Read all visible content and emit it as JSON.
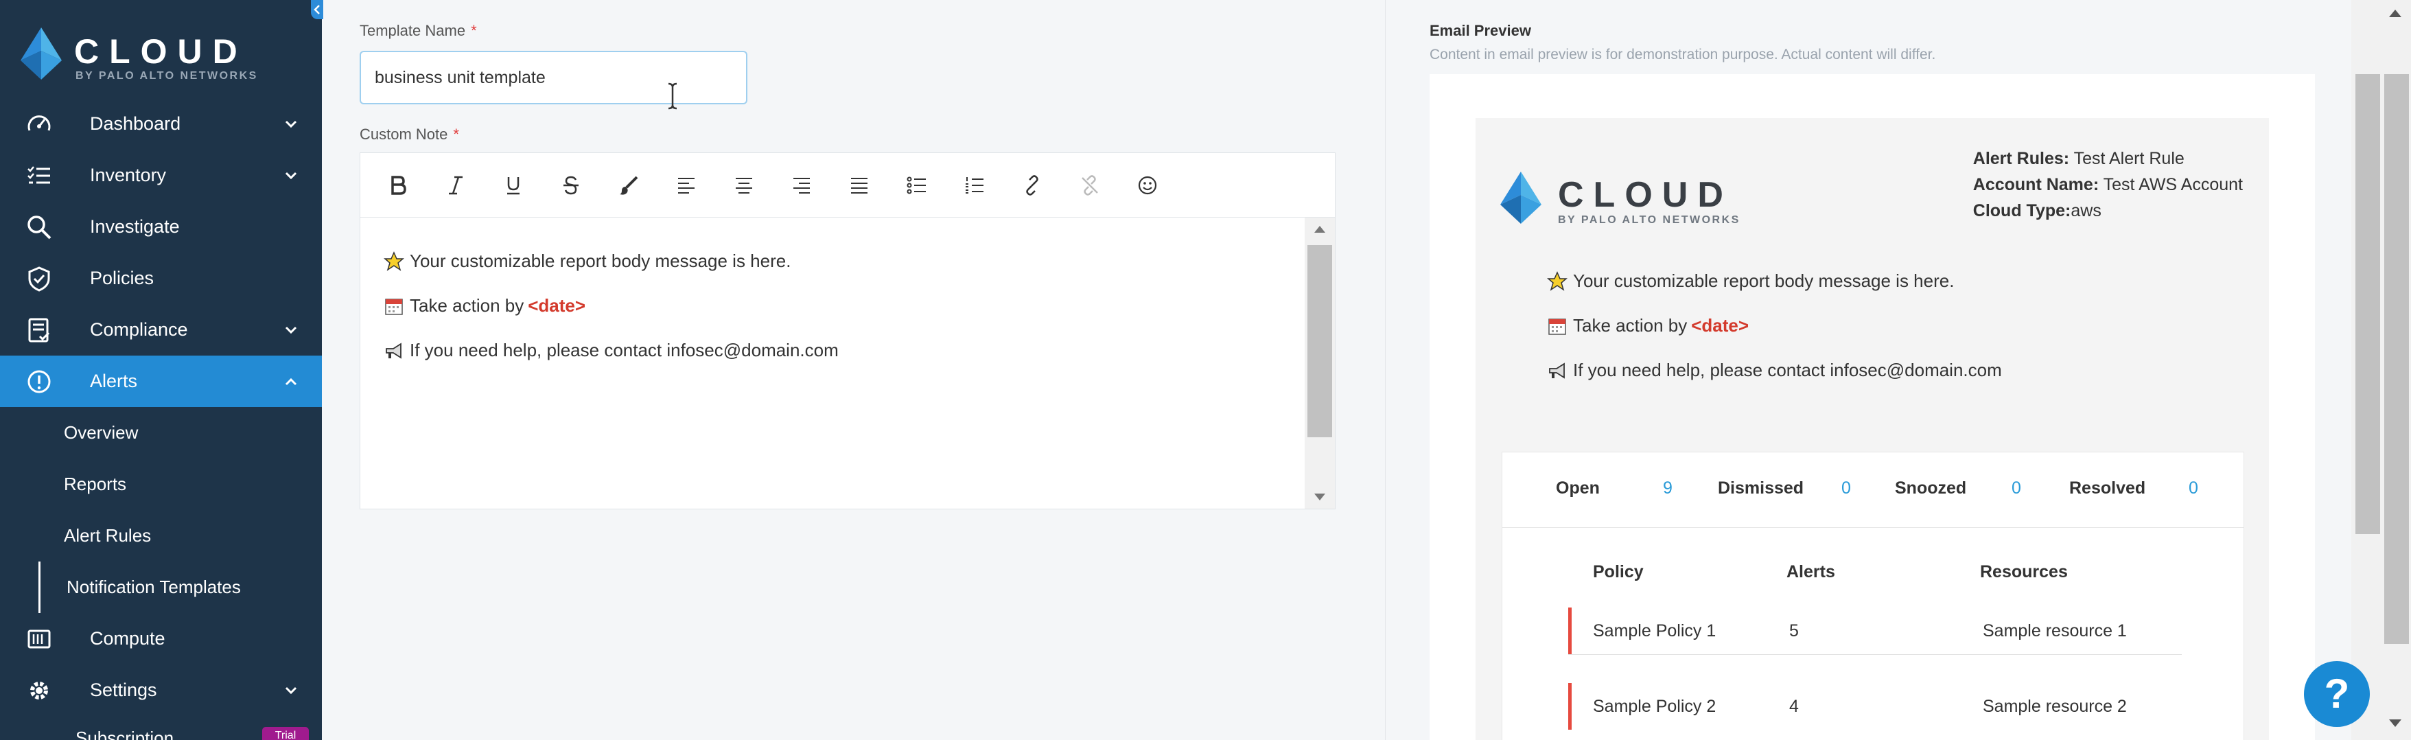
{
  "brand": {
    "name": "CLOUD",
    "tagline": "BY PALO ALTO NETWORKS"
  },
  "sidebar": {
    "items": [
      {
        "label": "Dashboard",
        "icon": "speedometer-icon",
        "has_children": true
      },
      {
        "label": "Inventory",
        "icon": "list-icon",
        "has_children": true
      },
      {
        "label": "Investigate",
        "icon": "search-icon",
        "has_children": false
      },
      {
        "label": "Policies",
        "icon": "shield-check-icon",
        "has_children": false
      },
      {
        "label": "Compliance",
        "icon": "report-icon",
        "has_children": true
      },
      {
        "label": "Alerts",
        "icon": "alert-circle-icon",
        "has_children": true,
        "expanded": true
      }
    ],
    "alerts_children": [
      {
        "label": "Overview"
      },
      {
        "label": "Reports"
      },
      {
        "label": "Alert Rules"
      },
      {
        "label": "Notification Templates",
        "current": true
      }
    ],
    "after_items": [
      {
        "label": "Compute",
        "icon": "server-icon",
        "has_children": false
      },
      {
        "label": "Settings",
        "icon": "gear-icon",
        "has_children": true
      }
    ],
    "partial_item": {
      "label": "Subscription",
      "badge": "Trial"
    }
  },
  "form": {
    "template_name_label": "Template Name",
    "template_name_value": "business unit template",
    "custom_note_label": "Custom Note",
    "required_mark": "*",
    "toolbar": [
      "bold",
      "italic",
      "underline",
      "strikethrough",
      "brush",
      "align-left",
      "align-center",
      "align-right",
      "align-justify",
      "bulleted-list",
      "numbered-list",
      "link",
      "unlink",
      "emoji"
    ],
    "note_lines": [
      {
        "emoji": "star",
        "text": "Your customizable report body message is here."
      },
      {
        "emoji": "calendar",
        "text": "Take action by",
        "tag": "<date>"
      },
      {
        "emoji": "megaphone",
        "text": "If you need help, please contact infosec@domain.com"
      }
    ]
  },
  "preview": {
    "title": "Email Preview",
    "subtitle": "Content in email preview is for demonstration purpose. Actual content will differ.",
    "meta": {
      "alert_rules_label": "Alert Rules:",
      "alert_rules_value": "Test Alert Rule",
      "account_name_label": "Account Name:",
      "account_name_value": "Test AWS Account",
      "cloud_type_label": "Cloud Type:",
      "cloud_type_value": "aws"
    },
    "stats": [
      {
        "label": "Open",
        "value": "9"
      },
      {
        "label": "Dismissed",
        "value": "0"
      },
      {
        "label": "Snoozed",
        "value": "0"
      },
      {
        "label": "Resolved",
        "value": "0"
      }
    ],
    "table": {
      "headers": [
        "Policy",
        "Alerts",
        "Resources"
      ],
      "rows": [
        [
          "Sample Policy 1",
          "5",
          "Sample resource 1"
        ],
        [
          "Sample Policy 2",
          "4",
          "Sample resource 2"
        ]
      ]
    }
  },
  "help": {
    "label": "?"
  },
  "colors": {
    "sidebar_bg": "#1e3449",
    "active_blue": "#238bd4",
    "accent_red": "#d33a2c",
    "stat_blue": "#2a9bd8",
    "trial_badge": "#a01b8e"
  }
}
